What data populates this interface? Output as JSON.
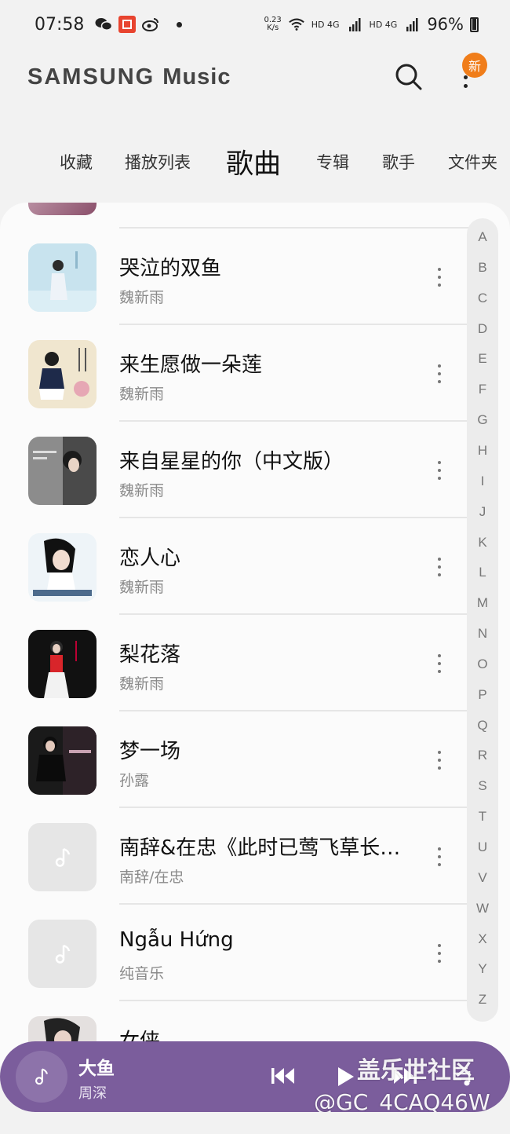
{
  "status_bar": {
    "time": "07:58",
    "net_speed_value": "0.23",
    "net_speed_unit": "K/s",
    "signal1": "HD 4G",
    "signal2": "HD 4G",
    "battery": "96%"
  },
  "app_bar": {
    "brand": "SAMSUNG",
    "brand_suffix": "Music",
    "new_badge": "新"
  },
  "tabs": [
    {
      "label": "收藏"
    },
    {
      "label": "播放列表"
    },
    {
      "label": "歌曲"
    },
    {
      "label": "专辑"
    },
    {
      "label": "歌手"
    },
    {
      "label": "文件夹"
    }
  ],
  "songs": [
    {
      "title": "哭泣的双鱼",
      "artist": "魏新雨"
    },
    {
      "title": "来生愿做一朵莲",
      "artist": "魏新雨"
    },
    {
      "title": "来自星星的你（中文版）",
      "artist": "魏新雨"
    },
    {
      "title": "恋人心",
      "artist": "魏新雨"
    },
    {
      "title": "梨花落",
      "artist": "魏新雨"
    },
    {
      "title": "梦一场",
      "artist": "孙露"
    },
    {
      "title": "南辞&在忠《此时已莺飞草长…",
      "artist": "南辞/在忠"
    },
    {
      "title": "Ngẫu Hứng",
      "artist": "纯音乐"
    },
    {
      "title": "女侠",
      "artist": ""
    }
  ],
  "alphabet": [
    "A",
    "B",
    "C",
    "D",
    "E",
    "F",
    "G",
    "H",
    "I",
    "J",
    "K",
    "L",
    "M",
    "N",
    "O",
    "P",
    "Q",
    "R",
    "S",
    "T",
    "U",
    "V",
    "W",
    "X",
    "Y",
    "Z"
  ],
  "mini_player": {
    "title": "大鱼",
    "artist": "周深"
  },
  "watermark": {
    "line1": "盖乐世社区",
    "line2": "@GC_4CAQ46W"
  },
  "colors": {
    "player_bg": "#7b5d9c",
    "badge": "#f07d1a"
  }
}
